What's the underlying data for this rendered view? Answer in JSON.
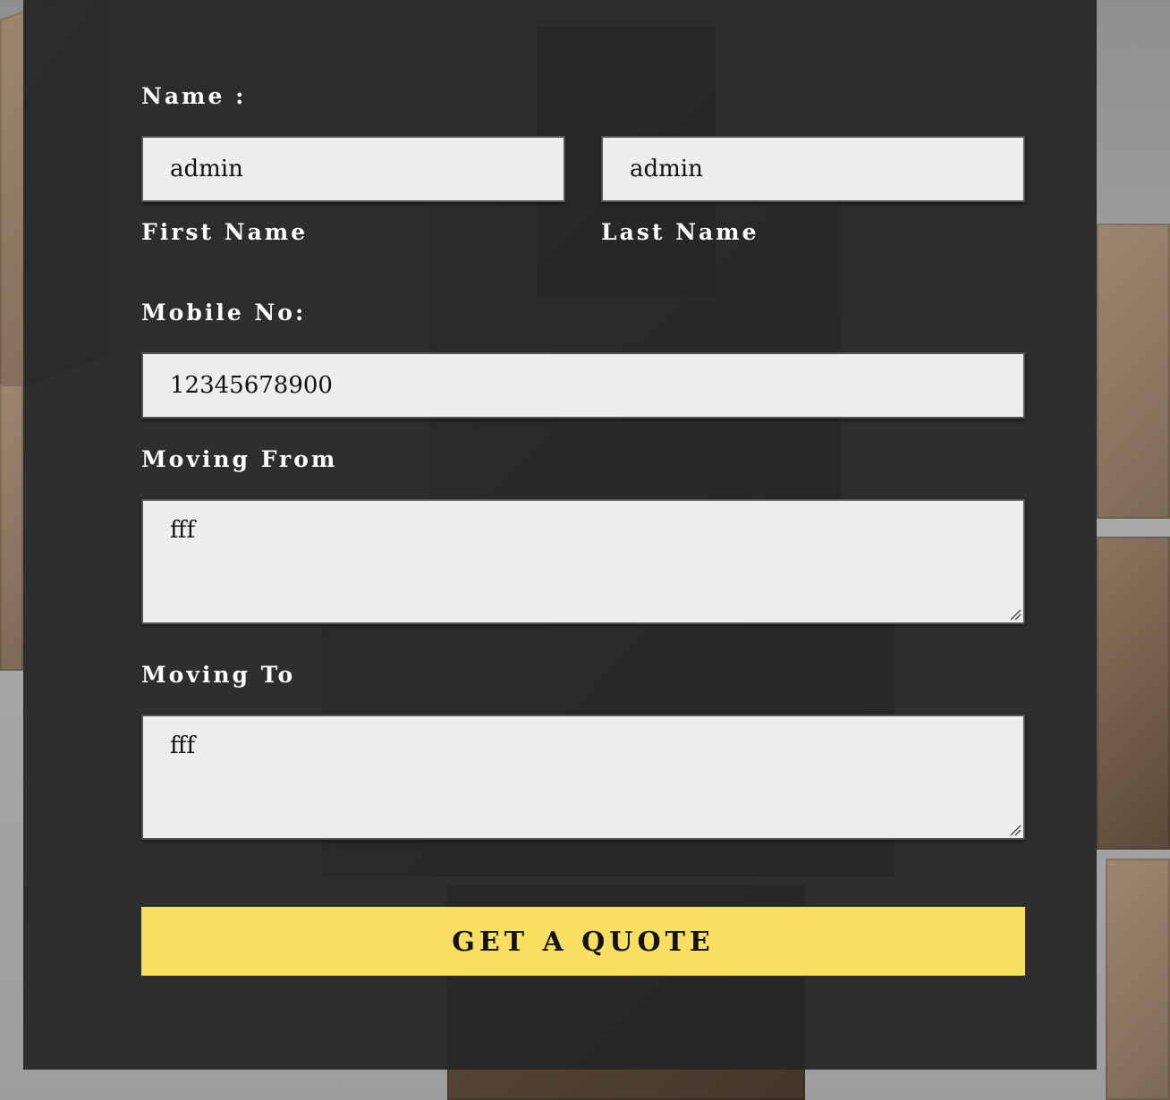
{
  "form": {
    "name_label": "Name :",
    "first_name": {
      "value": "admin",
      "caption": "First Name"
    },
    "last_name": {
      "value": "admin",
      "caption": "Last Name"
    },
    "mobile_label": "Mobile No:",
    "mobile_value": "12345678900",
    "moving_from_label": "Moving From",
    "moving_from_value": "fff",
    "moving_to_label": "Moving To",
    "moving_to_value": "fff",
    "submit_label": "GET A QUOTE"
  },
  "colors": {
    "panel": "#262626",
    "field_bg": "#eeeeee",
    "button_bg": "#f8df5f",
    "label_text": "#ffffff"
  },
  "icons": {
    "textarea_grip": "resize-grip-icon"
  }
}
